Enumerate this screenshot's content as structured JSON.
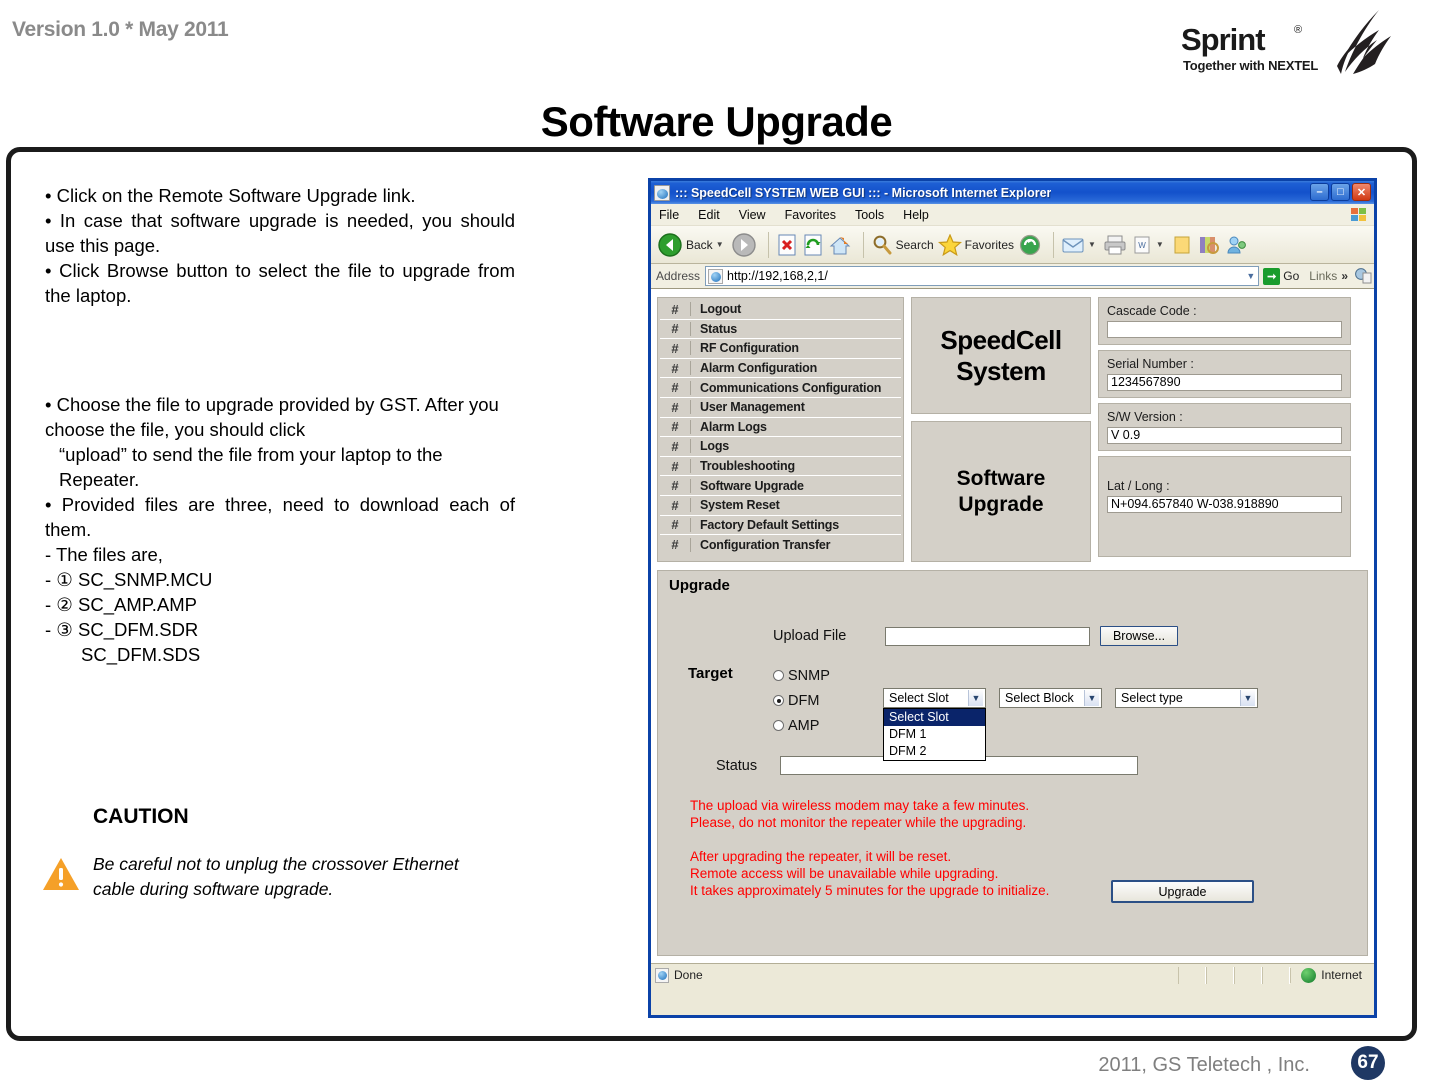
{
  "slide": {
    "version_label": "Version 1.0 * May 2011",
    "title": "Software Upgrade",
    "logo": {
      "brand": "Sprint",
      "registered": "®",
      "tagline": "Together with NEXTEL"
    },
    "footer": {
      "copyright": "2011, GS Teletech , Inc.",
      "page_number": "67"
    }
  },
  "left_column": {
    "bullets_group1": [
      "• Click on the Remote Software Upgrade link.",
      "• In case that software upgrade is needed, you should use this page.",
      "• Click Browse button to select the file to upgrade from the laptop."
    ],
    "bullets_group2": [
      "• Choose the file to upgrade provided  by GST. After you choose the file, you should click",
      "“upload” to send the file from your laptop to the Repeater.",
      "• Provided files are three, need to download each of them.",
      "- The files are,",
      "- ① SC_SNMP.MCU",
      "- ② SC_AMP.AMP",
      "- ③ SC_DFM.SDR",
      "SC_DFM.SDS"
    ],
    "caution": {
      "title": "CAUTION",
      "icon": "warning-triangle-icon",
      "body": "Be careful not to unplug the crossover Ethernet cable during software upgrade."
    }
  },
  "browser": {
    "title": "::: SpeedCell SYSTEM WEB GUI ::: - Microsoft Internet Explorer",
    "title_icon": "ie-page-icon",
    "window_buttons": [
      {
        "name": "minimize-button",
        "glyph": "–"
      },
      {
        "name": "maximize-button",
        "glyph": "□"
      },
      {
        "name": "close-button",
        "glyph": "✕"
      }
    ],
    "menu": [
      "File",
      "Edit",
      "View",
      "Favorites",
      "Tools",
      "Help"
    ],
    "toolbar": {
      "back_label": "Back",
      "search_label": "Search",
      "favorites_label": "Favorites",
      "icons": [
        "back-icon",
        "forward-icon",
        "stop-icon",
        "refresh-icon",
        "home-icon",
        "search-icon",
        "favorites-star-icon",
        "history-icon",
        "mail-icon",
        "print-icon",
        "edit-icon",
        "notes-icon",
        "research-icon",
        "messenger-icon"
      ]
    },
    "address": {
      "label": "Address",
      "url": "http://192,168,2,1/",
      "go_label": "Go",
      "links_label": "Links"
    },
    "statusbar": {
      "text": "Done",
      "zone": "Internet",
      "zone_icon": "globe-icon"
    }
  },
  "webpage": {
    "nav_items": [
      "Logout",
      "Status",
      "RF Configuration",
      "Alarm Configuration",
      "Communications Configuration",
      "User Management",
      "Alarm Logs",
      "Logs",
      "Troubleshooting",
      "Software Upgrade",
      "System Reset",
      "Factory Default Settings",
      "Configuration Transfer"
    ],
    "nav_bullet": "#",
    "brand_title": "SpeedCell\nSystem",
    "section_title": "Software\nUpgrade",
    "info_fields": [
      {
        "label": "Cascade Code :",
        "value": ""
      },
      {
        "label": "Serial Number :",
        "value": "1234567890"
      },
      {
        "label": "S/W Version :",
        "value": "V 0.9"
      },
      {
        "label": "Lat / Long :",
        "value": "N+094.657840 W-038.918890"
      }
    ],
    "upgrade": {
      "heading": "Upgrade",
      "upload_file_label": "Upload File",
      "upload_file_value": "",
      "browse_label": "Browse...",
      "target_label": "Target",
      "radios": [
        {
          "label": "SNMP",
          "selected": false
        },
        {
          "label": "DFM",
          "selected": true
        },
        {
          "label": "AMP",
          "selected": false
        }
      ],
      "select_slot": {
        "value": "Select Slot",
        "open": true,
        "options": [
          "Select Slot",
          "DFM 1",
          "DFM 2"
        ],
        "selected_index": 0
      },
      "select_block": {
        "value": "Select Block"
      },
      "select_type": {
        "value": "Select type"
      },
      "status_label": "Status",
      "status_value": "",
      "warning_lines_1": [
        "The upload via wireless modem may take a few minutes.",
        "Please, do not monitor the repeater while the upgrading."
      ],
      "warning_lines_2": [
        "After upgrading the repeater, it will be reset.",
        "Remote access will be unavailable while upgrading.",
        "It takes approximately 5 minutes for the upgrade to initialize."
      ],
      "upgrade_button": "Upgrade"
    }
  }
}
